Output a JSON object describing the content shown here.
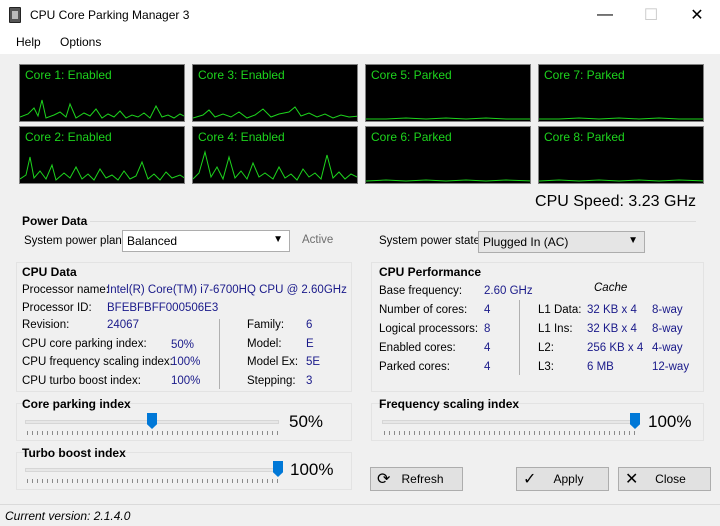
{
  "window": {
    "title": "CPU Core Parking Manager 3",
    "minimize": "—",
    "maximize": "☐",
    "close": "✕"
  },
  "menu": {
    "help": "Help",
    "options": "Options"
  },
  "cores": [
    {
      "label": "Core 1: Enabled"
    },
    {
      "label": "Core 2: Enabled"
    },
    {
      "label": "Core 3: Enabled"
    },
    {
      "label": "Core 4: Enabled"
    },
    {
      "label": "Core 5: Parked"
    },
    {
      "label": "Core 6: Parked"
    },
    {
      "label": "Core 7: Parked"
    },
    {
      "label": "Core 8: Parked"
    }
  ],
  "graph_color": "#1dd41d",
  "cpu_speed": "CPU Speed: 3.23 GHz",
  "power": {
    "title": "Power Data",
    "plan_label": "System power plan:",
    "plan_value": "Balanced",
    "plan_status": "Active",
    "state_label": "System power state:",
    "state_value": "Plugged In (AC)"
  },
  "cpu_data": {
    "title": "CPU Data",
    "processor_name_label": "Processor name:",
    "processor_name": "Intel(R) Core(TM) i7-6700HQ CPU @ 2.60GHz",
    "processor_id_label": "Processor ID:",
    "processor_id": "BFEBFBFF000506E3",
    "revision_label": "Revision:",
    "revision": "24067",
    "parking_index_label": "CPU core parking index:",
    "parking_index": "50%",
    "freq_scaling_label": "CPU frequency scaling index:",
    "freq_scaling": "100%",
    "turbo_label": "CPU turbo boost index:",
    "turbo": "100%",
    "family_label": "Family:",
    "family": "6",
    "model_label": "Model:",
    "model": "E",
    "model_ex_label": "Model Ex:",
    "model_ex": "5E",
    "stepping_label": "Stepping:",
    "stepping": "3"
  },
  "cpu_perf": {
    "title": "CPU Performance",
    "cache_title": "Cache",
    "base_freq_label": "Base frequency:",
    "base_freq": "2.60 GHz",
    "num_cores_label": "Number of cores:",
    "num_cores": "4",
    "logical_label": "Logical processors:",
    "logical": "8",
    "enabled_label": "Enabled cores:",
    "enabled": "4",
    "parked_label": "Parked cores:",
    "parked": "4",
    "l1d_label": "L1 Data:",
    "l1d_size": "32 KB x 4",
    "l1d_way": "8-way",
    "l1i_label": "L1 Ins:",
    "l1i_size": "32 KB x 4",
    "l1i_way": "8-way",
    "l2_label": "L2:",
    "l2_size": "256 KB x 4",
    "l2_way": "4-way",
    "l3_label": "L3:",
    "l3_size": "6 MB",
    "l3_way": "12-way"
  },
  "sliders": {
    "parking": {
      "title": "Core parking index",
      "value": 0.5,
      "label": "50%"
    },
    "frequency": {
      "title": "Frequency scaling index",
      "value": 1.0,
      "label": "100%"
    },
    "turbo": {
      "title": "Turbo boost index",
      "value": 1.0,
      "label": "100%"
    }
  },
  "buttons": {
    "refresh": "Refresh",
    "apply": "Apply",
    "close": "Close"
  },
  "status": "Current version:  2.1.4.0"
}
